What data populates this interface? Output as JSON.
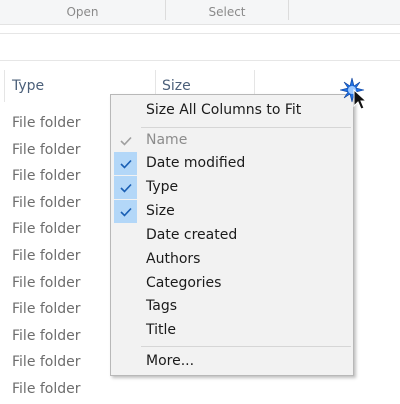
{
  "ribbon": {
    "groups": [
      {
        "label": "Open"
      },
      {
        "label": "Select"
      }
    ]
  },
  "columns": [
    {
      "label": "Type"
    },
    {
      "label": "Size"
    }
  ],
  "rows": [
    {
      "type": "File folder"
    },
    {
      "type": "File folder"
    },
    {
      "type": "File folder"
    },
    {
      "type": "File folder"
    },
    {
      "type": "File folder"
    },
    {
      "type": "File folder"
    },
    {
      "type": "File folder"
    },
    {
      "type": "File folder"
    },
    {
      "type": "File folder"
    },
    {
      "type": "File folder"
    },
    {
      "type": "File folder"
    }
  ],
  "context_menu": {
    "size_all_label": "Size All Columns to Fit",
    "items": [
      {
        "label": "Name",
        "checked": true,
        "disabled": true
      },
      {
        "label": "Date modified",
        "checked": true,
        "disabled": false
      },
      {
        "label": "Type",
        "checked": true,
        "disabled": false
      },
      {
        "label": "Size",
        "checked": true,
        "disabled": false
      },
      {
        "label": "Date created",
        "checked": false,
        "disabled": false
      },
      {
        "label": "Authors",
        "checked": false,
        "disabled": false
      },
      {
        "label": "Categories",
        "checked": false,
        "disabled": false
      },
      {
        "label": "Tags",
        "checked": false,
        "disabled": false
      },
      {
        "label": "Title",
        "checked": false,
        "disabled": false
      }
    ],
    "more_label": "More..."
  },
  "colors": {
    "check_highlight": "#b3d7f8",
    "check_color": "#1a5fb4",
    "check_disabled_color": "#a0a0a0",
    "header_text": "#4c607a",
    "cursor_burst": "#1f6fe0"
  },
  "icons": {
    "check": "checkmark-icon",
    "cursor": "mouse-pointer-icon"
  }
}
